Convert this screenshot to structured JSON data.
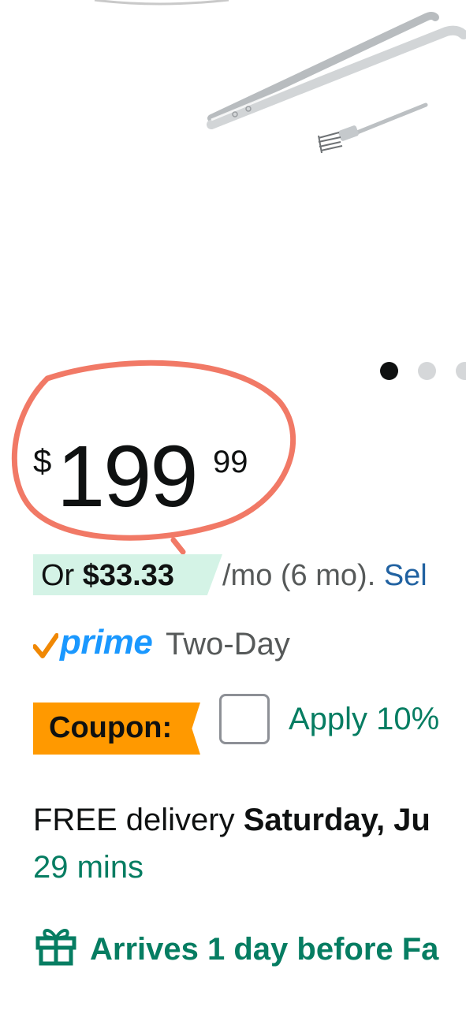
{
  "carousel": {
    "dots_visible": 3,
    "active_index": 0
  },
  "price": {
    "symbol": "$",
    "whole": "199",
    "fraction": "99"
  },
  "installment": {
    "prefix": "Or ",
    "amount": "$33.33",
    "suffix": " /mo (6 mo). ",
    "link": "Sel"
  },
  "prime": {
    "badge": "prime",
    "shipping": "Two-Day"
  },
  "coupon": {
    "label": "Coupon:",
    "apply_text": "Apply 10%",
    "checked": false
  },
  "delivery": {
    "prefix": "FREE delivery ",
    "date": "Saturday, Ju",
    "countdown": "29 mins"
  },
  "arrives": {
    "text": "Arrives 1 day before Fa",
    "icon": "gift-icon"
  },
  "colors": {
    "prime_blue": "#1a98ff",
    "deal_green": "#067d62",
    "coupon_orange": "#ff9900",
    "installment_bg": "#d4f3e6",
    "annotation_red": "#f06a55"
  }
}
